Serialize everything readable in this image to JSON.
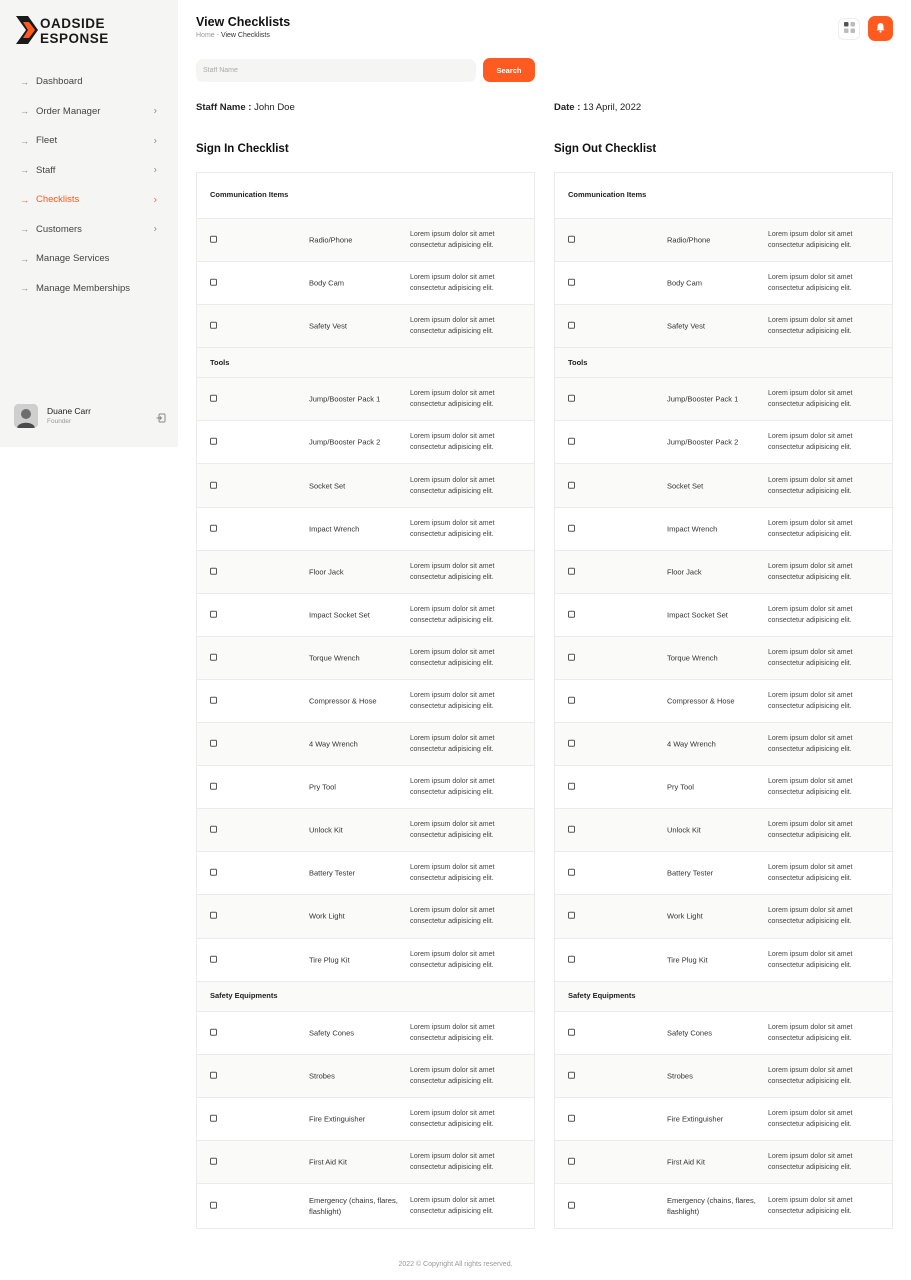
{
  "brand": {
    "line1": "ROADSIDE",
    "line2": "RESPONSE",
    "accent": "#ff5a1f"
  },
  "sidebar": {
    "items": [
      {
        "label": "Dashboard",
        "has_chevron": false,
        "active": false
      },
      {
        "label": "Order Manager",
        "has_chevron": true,
        "active": false
      },
      {
        "label": "Fleet",
        "has_chevron": true,
        "active": false
      },
      {
        "label": "Staff",
        "has_chevron": true,
        "active": false
      },
      {
        "label": "Checklists",
        "has_chevron": true,
        "active": true
      },
      {
        "label": "Customers",
        "has_chevron": true,
        "active": false
      },
      {
        "label": "Manage Services",
        "has_chevron": false,
        "active": false
      },
      {
        "label": "Manage Memberships",
        "has_chevron": false,
        "active": false
      }
    ],
    "user": {
      "name": "Duane Carr",
      "role": "Founder"
    }
  },
  "header": {
    "title": "View Checklists",
    "breadcrumb": {
      "home": "Home",
      "sep": "-",
      "current": "View Checklists"
    }
  },
  "search": {
    "placeholder": "Staff Name",
    "button": "Search"
  },
  "meta": {
    "staff_label": "Staff Name :",
    "staff_value": "John Doe",
    "date_label": "Date :",
    "date_value": "13 April, 2022"
  },
  "sections": {
    "sign_in": "Sign In Checklist",
    "sign_out": "Sign Out Checklist"
  },
  "checklist": {
    "description": "Lorem ipsum dolor sit amet consectetur adipisicing elit.",
    "groups": [
      {
        "name": "Communication Items",
        "items": [
          "Radio/Phone",
          "Body Cam",
          "Safety Vest"
        ]
      },
      {
        "name": "Tools",
        "items": [
          "Jump/Booster Pack 1",
          "Jump/Booster Pack 2",
          "Socket Set",
          "Impact Wrench",
          "Floor Jack",
          "Impact Socket Set",
          "Torque Wrench",
          "Compressor & Hose",
          "4 Way Wrench",
          "Pry Tool",
          "Unlock Kit",
          "Battery Tester",
          "Work Light",
          "Tire Plug Kit"
        ]
      },
      {
        "name": "Safety Equipments",
        "items": [
          "Safety Cones",
          "Strobes",
          "Fire Extinguisher",
          "First Aid Kit",
          "Emergency (chains, flares, flashlight)"
        ]
      }
    ]
  },
  "footer": "2022 © Copyright All rights reserved."
}
